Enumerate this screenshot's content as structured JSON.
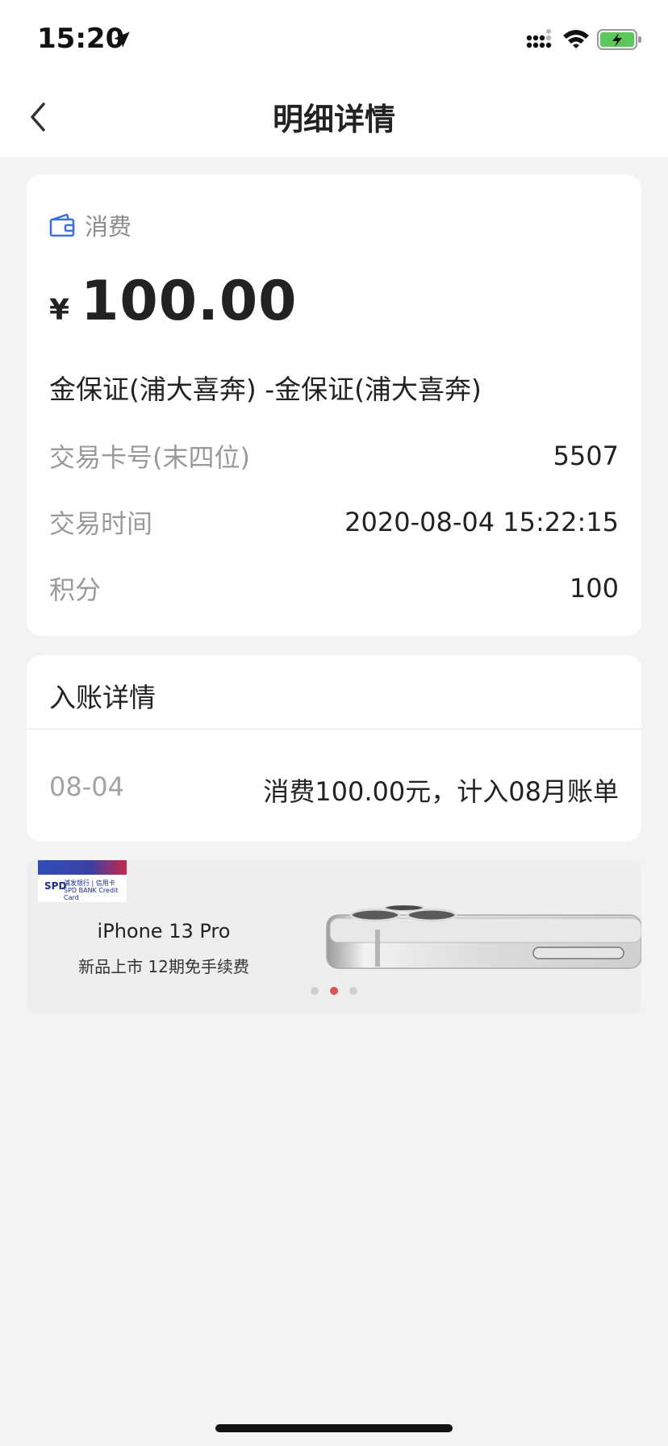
{
  "status_bar": {
    "time": "15:20"
  },
  "nav": {
    "title": "明细详情"
  },
  "transaction": {
    "category": "消费",
    "currency": "¥",
    "amount": "100.00",
    "merchant": "金保证(浦大喜奔) -金保证(浦大喜奔)",
    "card_label": "交易卡号(末四位)",
    "card_value": "5507",
    "time_label": "交易时间",
    "time_value": "2020-08-04 15:22:15",
    "points_label": "积分",
    "points_value": "100"
  },
  "posting": {
    "title": "入账详情",
    "date": "08-04",
    "description": "消费100.00元，计入08月账单"
  },
  "banner": {
    "brand_line": "浦发银行 | 信用卡",
    "brand_en": "SPD BANK  Credit Card",
    "title": "iPhone 13 Pro",
    "subtitle": "新品上市 12期免手续费",
    "active_slide": 2,
    "slide_count": 3
  },
  "colors": {
    "accent_blue": "#3a6fe0",
    "dot_active": "#d9534f",
    "battery_green": "#5ac85a"
  }
}
